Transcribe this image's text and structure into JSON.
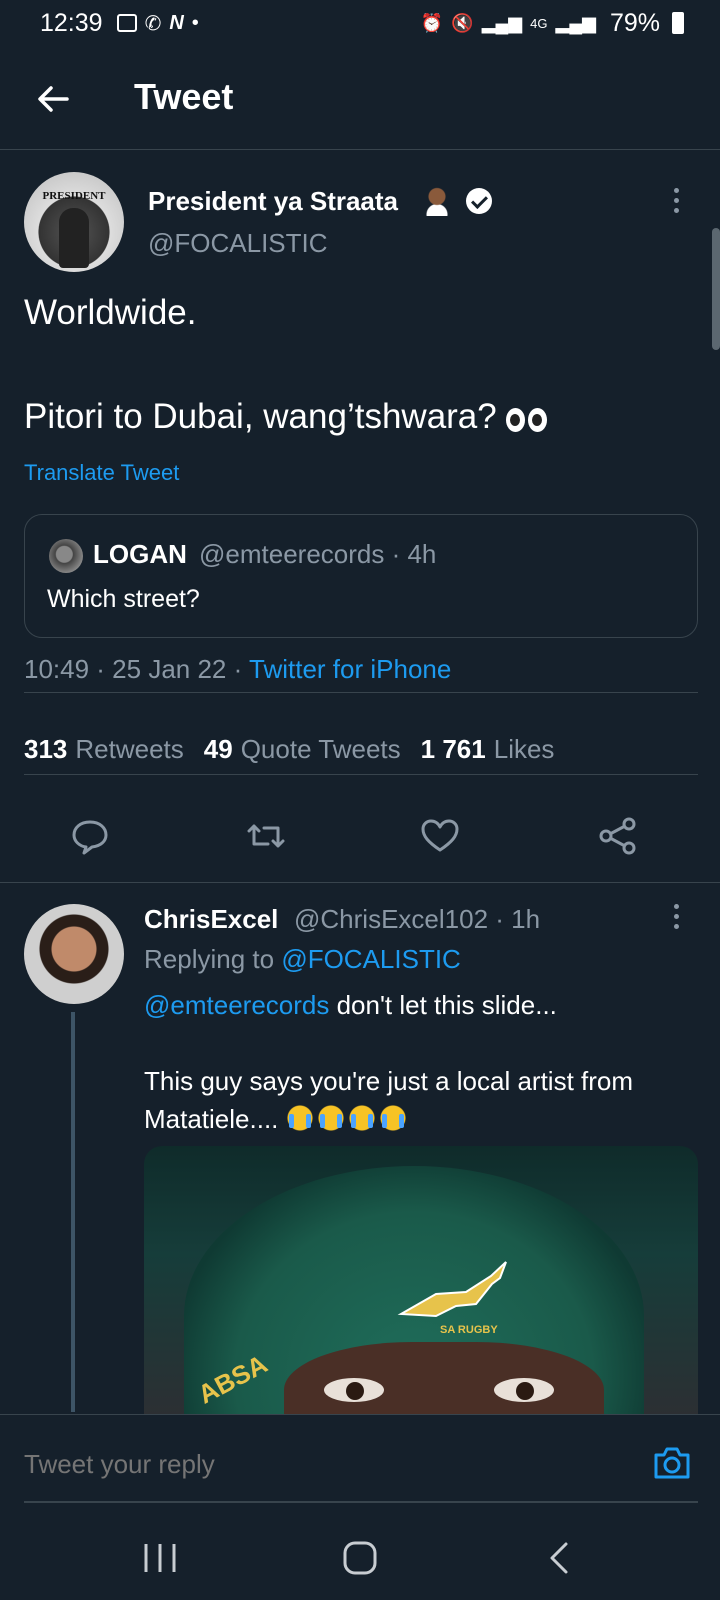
{
  "status_bar": {
    "time": "12:39",
    "network": "4G",
    "battery_percent": "79%"
  },
  "header": {
    "title": "Tweet"
  },
  "tweet": {
    "author_name": "President ya Straata",
    "author_handle": "@FOCALISTIC",
    "avatar_text": "PRESIDENT",
    "text_line1": "Worldwide.",
    "text_line2": "Pitori to Dubai, wang’tshwara?",
    "translate": "Translate Tweet",
    "quote": {
      "name": "LOGAN",
      "meta": "@emteerecords · 4h",
      "text": "Which street?"
    },
    "timestamp": "10:49 · 25 Jan 22 · ",
    "source": "Twitter for iPhone",
    "stats": {
      "retweets_count": "313",
      "retweets_label": "Retweets",
      "quotes_count": "49",
      "quotes_label": "Quote Tweets",
      "likes_count": "1 761",
      "likes_label": "Likes"
    }
  },
  "reply": {
    "name": "ChrisExcel",
    "meta": "@ChrisExcel102 · 1h",
    "replying_prefix": "Replying to ",
    "replying_handle": "@FOCALISTIC",
    "mention": "@emteerecords",
    "text_line1": " don't let this slide...",
    "text_line2": "This guy says you're just a local artist from Matatiele....",
    "image_text_brand": "ABSA",
    "image_text_team": "SA RUGBY"
  },
  "composer": {
    "placeholder": "Tweet your reply"
  },
  "colors": {
    "background": "#15202b",
    "accent": "#1d9bf0",
    "muted": "#8b98a5",
    "border": "#38444d"
  }
}
